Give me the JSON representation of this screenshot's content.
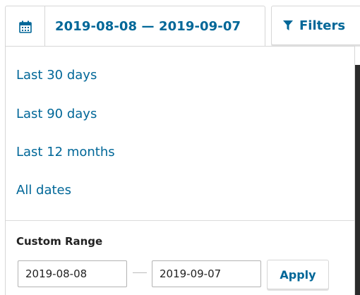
{
  "toolbar": {
    "date_range_label": "2019-08-08 — 2019-09-07",
    "date_icon": "calendar-icon",
    "filters_label": "Filters",
    "filters_icon": "filter-funnel-icon"
  },
  "dropdown": {
    "presets": [
      {
        "label": "Last 30 days"
      },
      {
        "label": "Last 90 days"
      },
      {
        "label": "Last 12 months"
      },
      {
        "label": "All dates"
      }
    ],
    "custom_range": {
      "title": "Custom Range",
      "from_value": "2019-08-08",
      "to_value": "2019-09-07",
      "apply_label": "Apply"
    }
  },
  "colors": {
    "accent": "#006798",
    "border": "#d6d6d6",
    "text": "#222222"
  }
}
